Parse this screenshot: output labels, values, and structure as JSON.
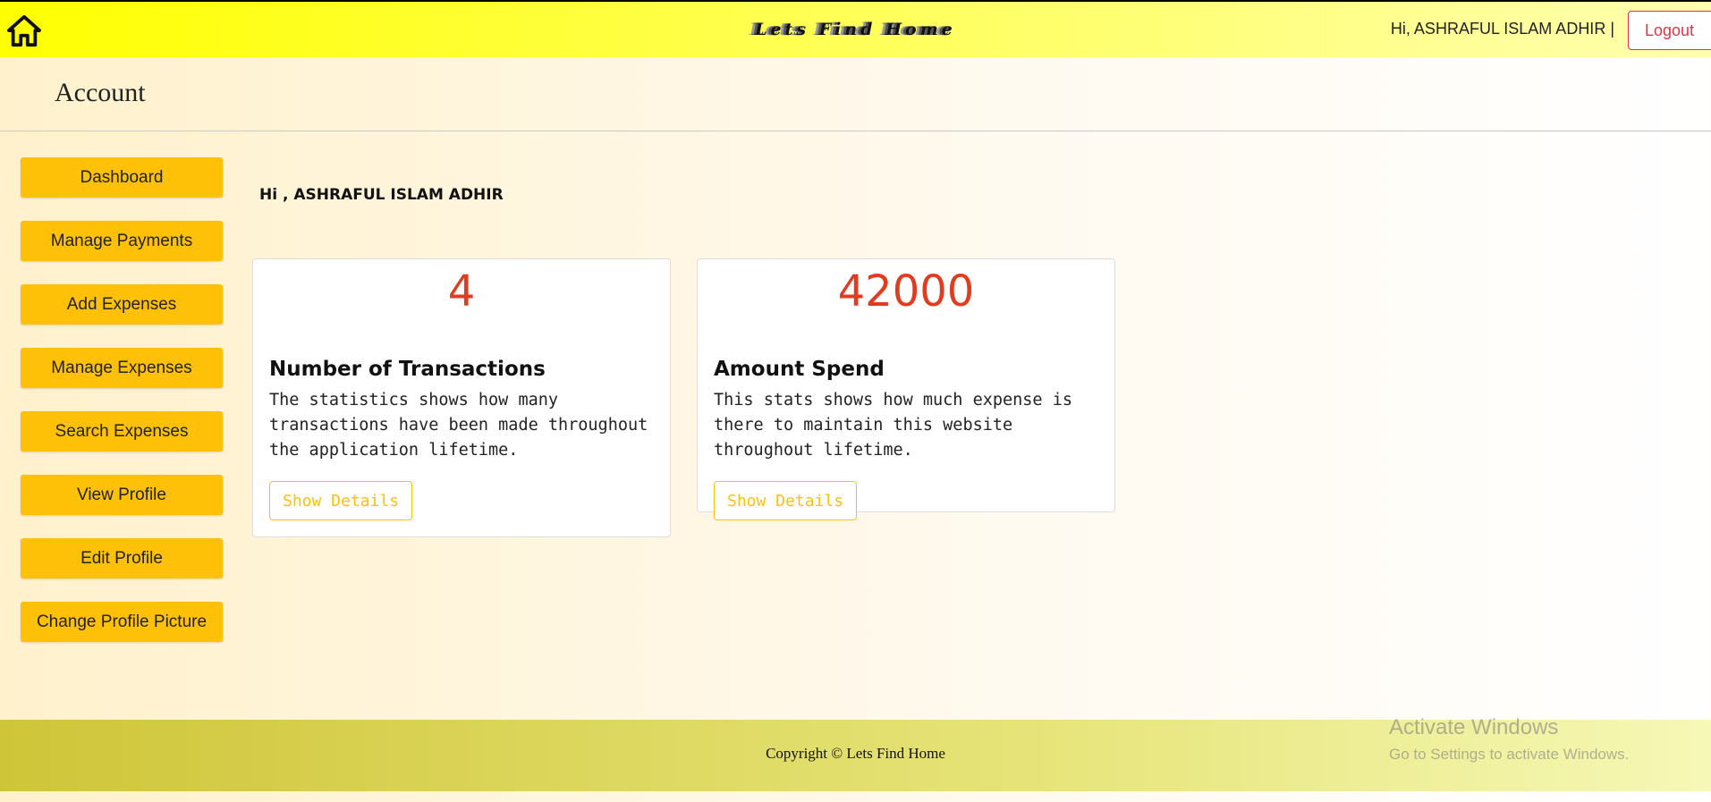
{
  "header": {
    "brand": "Lets Find Home",
    "greeting": "Hi, ASHRAFUL ISLAM ADHIR  |",
    "logout_label": "Logout",
    "home_icon": "home-icon"
  },
  "page": {
    "title": "Account"
  },
  "sidebar": {
    "items": [
      {
        "label": "Dashboard"
      },
      {
        "label": "Manage Payments"
      },
      {
        "label": "Add Expenses"
      },
      {
        "label": "Manage Expenses"
      },
      {
        "label": "Search Expenses"
      },
      {
        "label": "View Profile"
      },
      {
        "label": "Edit Profile"
      },
      {
        "label": "Change Profile Picture"
      }
    ]
  },
  "main": {
    "greeting": "Hi , ASHRAFUL ISLAM ADHIR",
    "cards": [
      {
        "number": "4",
        "title": "Number of Transactions",
        "text": "The statistics shows how many transactions have been made throughout the application lifetime.",
        "button": "Show Details"
      },
      {
        "number": "42000",
        "title": "Amount Spend",
        "text": "This stats shows how much expense is there to maintain this website throughout lifetime.",
        "button": "Show Details"
      }
    ]
  },
  "footer": {
    "copyright": "Copyright © Lets Find Home"
  },
  "watermark": {
    "title": "Activate Windows",
    "subtitle": "Go to Settings to activate Windows."
  },
  "colors": {
    "accent": "#ffc107",
    "number": "#e03c20",
    "logout": "#dc3545"
  }
}
